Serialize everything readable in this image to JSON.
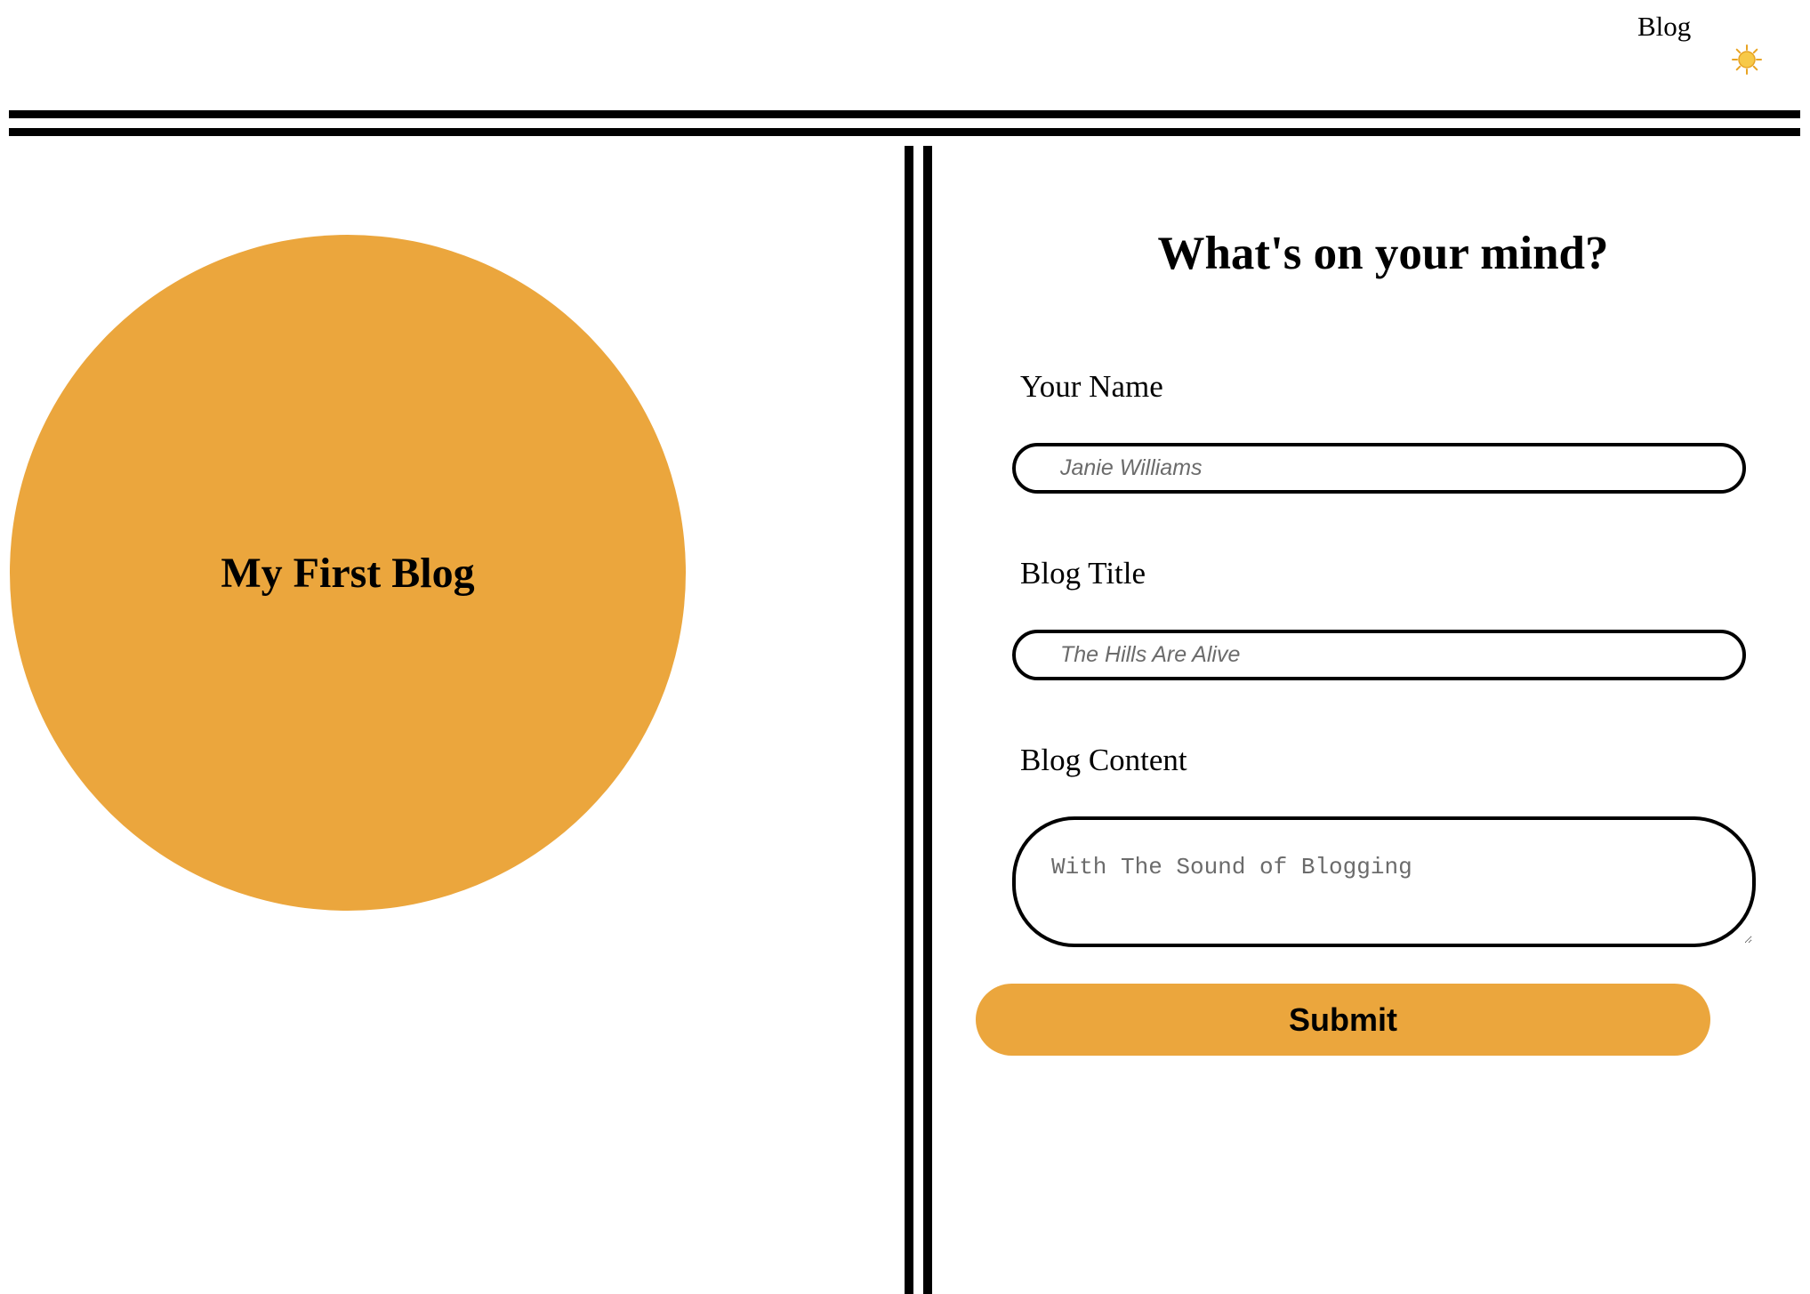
{
  "header": {
    "nav_link": "Blog",
    "theme_icon": "sun-icon",
    "theme_icon_color": "#f2b632"
  },
  "hero": {
    "title": "My First Blog",
    "circle_color": "#eba63d"
  },
  "form": {
    "heading": "What's on your mind?",
    "name_label": "Your Name",
    "name_placeholder": "Janie Williams",
    "title_label": "Blog Title",
    "title_placeholder": "The Hills Are Alive",
    "content_label": "Blog Content",
    "content_placeholder": "With The Sound of Blogging",
    "submit_label": "Submit",
    "accent_color": "#eba63d"
  }
}
